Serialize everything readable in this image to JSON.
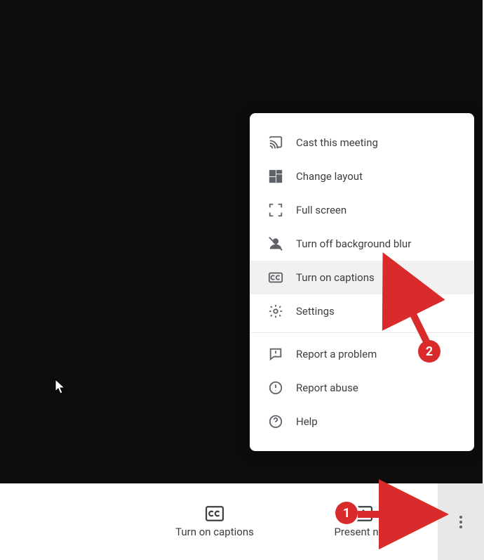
{
  "menu": {
    "items": [
      {
        "label": "Cast this meeting",
        "hover": false
      },
      {
        "label": "Change layout",
        "hover": false
      },
      {
        "label": "Full screen",
        "hover": false
      },
      {
        "label": "Turn off background blur",
        "hover": false
      },
      {
        "label": "Turn on captions",
        "hover": true
      },
      {
        "label": "Settings",
        "hover": false
      }
    ],
    "items2": [
      {
        "label": "Report a problem"
      },
      {
        "label": "Report abuse"
      },
      {
        "label": "Help"
      }
    ]
  },
  "bottom": {
    "captions": "Turn on captions",
    "present": "Present now"
  },
  "callouts": {
    "one": "1",
    "two": "2"
  }
}
